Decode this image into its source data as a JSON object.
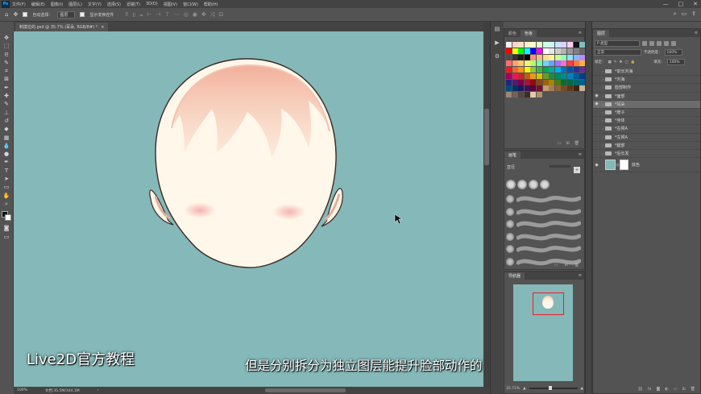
{
  "app": {
    "logo": "Ps",
    "menu": [
      "文件(F)",
      "编辑(E)",
      "图像(I)",
      "图层(L)",
      "文字(Y)",
      "选择(S)",
      "滤镜(T)",
      "3D(D)",
      "视图(V)",
      "窗口(W)",
      "帮助(H)"
    ],
    "window_controls": [
      "—",
      "□",
      "✕"
    ]
  },
  "options": {
    "move_icon": "✥",
    "auto_select_label": "自动选择：",
    "auto_select_value": "图层",
    "show_transform_label": "显示变换控件",
    "right_icons": [
      "⌕",
      "▭",
      "⇪"
    ]
  },
  "document": {
    "tab_title": "制摸拉的.psd @ 35.7% (耳朵, RGB/8#) *",
    "close": "×"
  },
  "status": {
    "zoom": "100%",
    "doc_info": "文档:35.5M/344.1M",
    "arrow": "›"
  },
  "tools": [
    "move-tool",
    "marquee-tool",
    "lasso-tool",
    "quick-select-tool",
    "crop-tool",
    "frame-tool",
    "eyedropper-tool",
    "healing-tool",
    "brush-tool",
    "stamp-tool",
    "history-brush-tool",
    "eraser-tool",
    "gradient-tool",
    "blur-tool",
    "dodge-tool",
    "pen-tool",
    "type-tool",
    "path-select-tool",
    "shape-tool",
    "hand-tool",
    "zoom-tool"
  ],
  "tool_glyphs": [
    "✥",
    "⬚",
    "ᘓ",
    "✎",
    "⌗",
    "⊠",
    "✒",
    "✚",
    "✎",
    "⊥",
    "↺",
    "◆",
    "▦",
    "💧",
    "●",
    "✒",
    "T",
    "➤",
    "▭",
    "✋",
    "⌕"
  ],
  "strip_icons": [
    "▤",
    "▶",
    "⚙"
  ],
  "swatches_panel": {
    "tabs": [
      "颜色",
      "色板"
    ],
    "active_tab": 1,
    "menu": "≡",
    "colors": [
      "#f2f2f2",
      "#ffd0cd",
      "#ffe0c8",
      "#fff0c8",
      "#ffffcc",
      "#e0ffcc",
      "#ccffe0",
      "#ccf4ff",
      "#cce0ff",
      "#e0ccff",
      "#ffccf0",
      "#111111",
      "#7fbfbf",
      "#ff0000",
      "#ffff00",
      "#00ff00",
      "#00ffff",
      "#0000ff",
      "#ff00ff",
      "#ffffff",
      "#e6e6e6",
      "#cccccc",
      "#b3b3b3",
      "#999999",
      "#808080",
      "#666666",
      "#4d4d4d",
      "#333333",
      "#1a1a1a",
      "#000000",
      "#ff8c8c",
      "#ffb98c",
      "#ffe08c",
      "#fff68c",
      "#c6ff8c",
      "#8cffc6",
      "#8ce0ff",
      "#8cb3ff",
      "#b98cff",
      "#ff6e6e",
      "#ff9e6e",
      "#ffc86e",
      "#fff06e",
      "#b0ff6e",
      "#6effa8",
      "#6ed4ff",
      "#6e9eff",
      "#a86eff",
      "#ff6ec8",
      "#ff3d3d",
      "#ff7a3d",
      "#ffb03d",
      "#ed1c24",
      "#f26522",
      "#f7941d",
      "#fff200",
      "#8dc63f",
      "#39b54a",
      "#00a651",
      "#00a99d",
      "#00aeef",
      "#0072bc",
      "#0054a6",
      "#2e3192",
      "#662d91",
      "#9e005d",
      "#ed145b",
      "#c1272d",
      "#c75b12",
      "#e89b23",
      "#d6c100",
      "#6a9a2e",
      "#1e8e3e",
      "#008a60",
      "#008c8c",
      "#0083c1",
      "#005b9a",
      "#003f7f",
      "#1d2679",
      "#4b1c79",
      "#7a0049",
      "#a4123f",
      "#8a0e0e",
      "#8b4513",
      "#a06010",
      "#9c8a00",
      "#4f7a1a",
      "#0f6a2e",
      "#006a4a",
      "#006a6a",
      "#00628f",
      "#004a7a",
      "#003366",
      "#17195e",
      "#3a1159",
      "#5a0036",
      "#7a0d2e",
      "#c69c6d",
      "#a67c52",
      "#8c6239",
      "#754c24",
      "#603913",
      "#3c2415",
      "#c7b299",
      "#998675",
      "#736357",
      "#534741",
      "#362f2d",
      "#e3c9a8",
      "#b38f6a"
    ]
  },
  "brush_panel": {
    "tabs": [
      "画笔"
    ],
    "menu": "≡",
    "label": "直径",
    "new_icon": "+"
  },
  "navigator_panel": {
    "tabs": [
      "导航器"
    ],
    "menu": "≡",
    "zoom": "35.71%"
  },
  "layers_panel": {
    "tabs": [
      "图层"
    ],
    "menu": "≡",
    "kind_label": "P 类型",
    "blend_mode": "正常",
    "opacity_label": "不透明度：",
    "opacity_value": "100%",
    "lock_label": "锁定：",
    "fill_label": "填充：",
    "fill_value": "100%",
    "layers": [
      {
        "name": "*前长刘海",
        "visible": false,
        "selected": false
      },
      {
        "name": "*刘海",
        "visible": false,
        "selected": false
      },
      {
        "name": "脸部制作",
        "visible": false,
        "selected": false
      },
      {
        "name": "*面部",
        "visible": true,
        "selected": false
      },
      {
        "name": "*耳朵",
        "visible": true,
        "selected": true
      },
      {
        "name": "*脖子",
        "visible": false,
        "selected": false
      },
      {
        "name": "*身体",
        "visible": false,
        "selected": false
      },
      {
        "name": "*右臂A",
        "visible": false,
        "selected": false
      },
      {
        "name": "*左臂A",
        "visible": false,
        "selected": false
      },
      {
        "name": "*腿部",
        "visible": false,
        "selected": false
      },
      {
        "name": "*后长发",
        "visible": false,
        "selected": false
      }
    ],
    "background_layer": "底色"
  },
  "overlay": {
    "watermark": "Live2D官方教程",
    "subtitle": "但是分别拆分为独立图层能提升脸部动作的流畅程度"
  },
  "colors": {
    "canvas_bg": "#85b8b8",
    "skin": "#fff7e9",
    "blush": "#f4b9b0",
    "outline": "#3a2a25"
  }
}
